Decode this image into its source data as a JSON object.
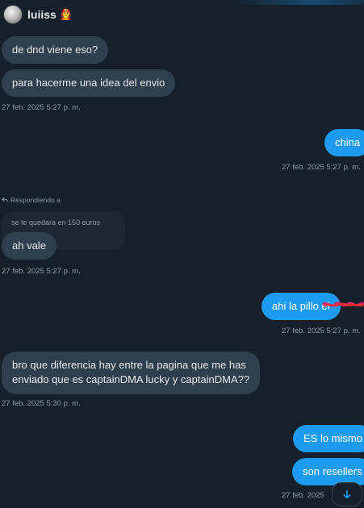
{
  "header": {
    "username": "luiiss",
    "emoji": "🧑‍🚒"
  },
  "messages": [
    {
      "dir": "in",
      "text": "de dnd viene eso?"
    },
    {
      "dir": "in",
      "text": "para hacerme una idea del envio"
    },
    {
      "ts": "27 feb. 2025 5:27 p. m."
    },
    {
      "dir": "out",
      "text": "china"
    },
    {
      "ts": "27 feb. 2025 5:27 p. m."
    },
    {
      "reply_hint": "Respondiendo a",
      "quoted": "se te quedara en 150 euros"
    },
    {
      "dir": "in",
      "text": "ah vale"
    },
    {
      "ts": "27 feb. 2025 5:27 p. m."
    },
    {
      "dir": "out",
      "text": "ahi la pillo el"
    },
    {
      "ts": "27 feb. 2025 5:27 p. m."
    },
    {
      "dir": "in",
      "line1": "bro que diferencia hay entre la pagina que me has",
      "line2": "enviado que es captainDMA lucky y captainDMA??"
    },
    {
      "ts": "27 feb. 2025 5:30 p. m."
    },
    {
      "dir": "out",
      "text": "ES lo mismo"
    },
    {
      "dir": "out",
      "text": "son resellers"
    },
    {
      "ts": "27 feb. 2025"
    }
  ],
  "icons": {
    "reply": "reply-arrow-icon",
    "scroll_down": "arrow-down-icon"
  },
  "colors": {
    "background": "#15202b",
    "incoming": "#2f3f4e",
    "outgoing": "#1d9bf0",
    "timestamp": "#8b98a5"
  }
}
